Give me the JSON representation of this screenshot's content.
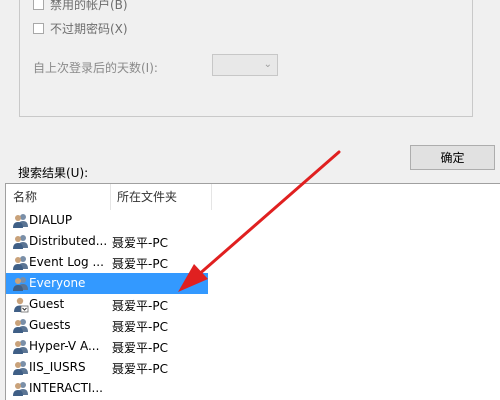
{
  "options": {
    "disabled_accounts_label": "禁用的帐户(B)",
    "non_expiring_password_label": "不过期密码(X)",
    "days_since_last_logon_label": "自上次登录后的天数(I):",
    "days_select_value": ""
  },
  "results": {
    "label": "搜索结果(U):",
    "ok_label": "确定",
    "columns": {
      "name": "名称",
      "folder": "所在文件夹"
    },
    "rows": [
      {
        "name": "DIALUP",
        "folder": "",
        "icon": "group-icon"
      },
      {
        "name": "Distributed...",
        "folder": "聂爱平-PC",
        "icon": "group-icon"
      },
      {
        "name": "Event Log ...",
        "folder": "聂爱平-PC",
        "icon": "group-icon"
      },
      {
        "name": "Everyone",
        "folder": "",
        "icon": "group-icon",
        "selected": true
      },
      {
        "name": "Guest",
        "folder": "聂爱平-PC",
        "icon": "user-icon"
      },
      {
        "name": "Guests",
        "folder": "聂爱平-PC",
        "icon": "group-icon"
      },
      {
        "name": "Hyper-V A...",
        "folder": "聂爱平-PC",
        "icon": "group-icon"
      },
      {
        "name": "IIS_IUSRS",
        "folder": "聂爱平-PC",
        "icon": "group-icon"
      },
      {
        "name": "INTERACTI...",
        "folder": "",
        "icon": "group-icon"
      }
    ]
  },
  "colors": {
    "selection": "#3399ff",
    "annotation_arrow": "#e02020"
  }
}
